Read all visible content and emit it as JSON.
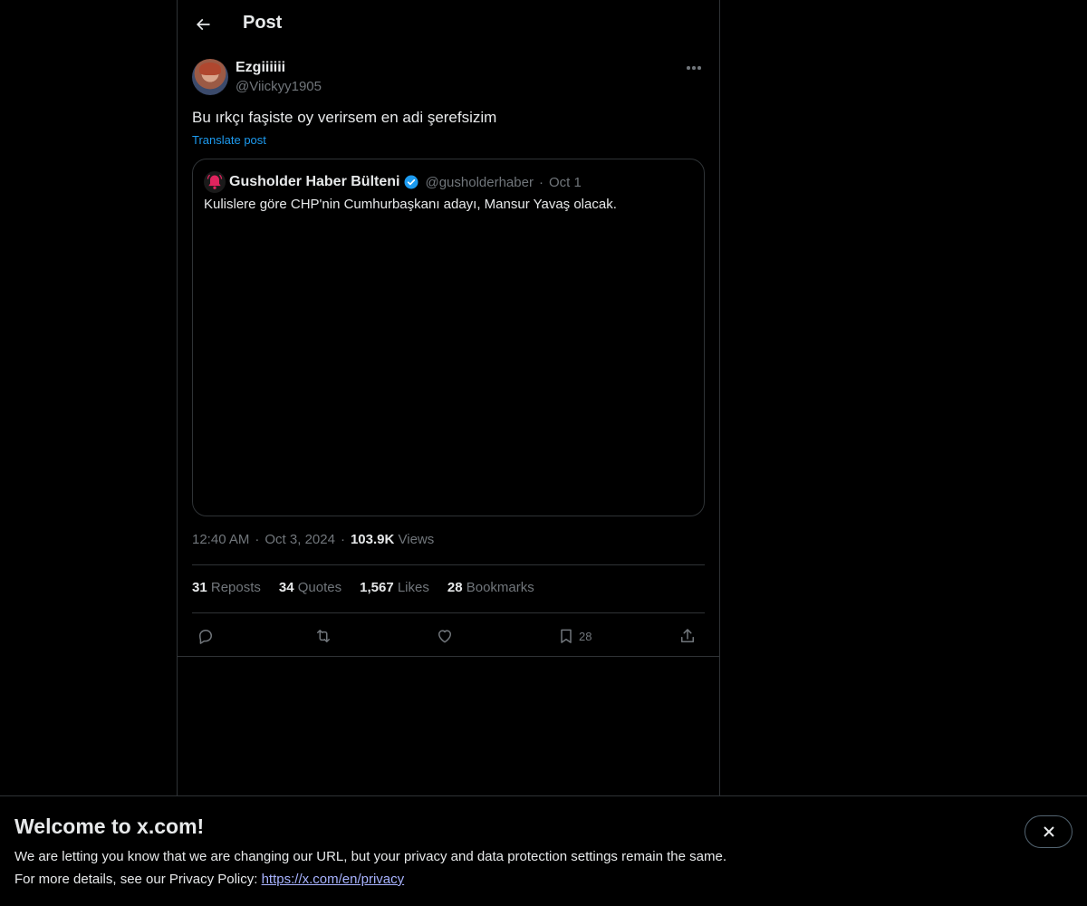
{
  "header": {
    "title": "Post",
    "back_icon": "arrow-left-icon"
  },
  "post": {
    "author_name": "Ezgiiiiii",
    "author_handle": "@Viickyy1905",
    "text": "Bu ırkçı faşiste oy verirsem en adi şerefsizim",
    "translate_label": "Translate post",
    "time": "12:40 AM",
    "date": "Oct 3, 2024",
    "views_count": "103.9K",
    "views_label": "Views"
  },
  "quote": {
    "author_name": "Gusholder Haber Bülteni",
    "author_handle": "@gusholderhaber",
    "date": "Oct 1",
    "text": "Kulislere göre CHP'nin Cumhurbaşkanı adayı, Mansur Yavaş olacak.",
    "verified_color": "#1d9bf0"
  },
  "stats": {
    "reposts_count": "31",
    "reposts_label": "Reposts",
    "quotes_count": "34",
    "quotes_label": "Quotes",
    "likes_count": "1,567",
    "likes_label": "Likes",
    "bookmarks_count": "28",
    "bookmarks_label": "Bookmarks"
  },
  "actions": {
    "bookmark_count": "28",
    "icons": [
      "reply-icon",
      "repost-icon",
      "like-icon",
      "bookmark-icon",
      "share-icon"
    ]
  },
  "banner": {
    "title": "Welcome to x.com!",
    "line1": "We are letting you know that we are changing our URL, but your privacy and data protection settings remain the same.",
    "line2_prefix": "For more details, see our Privacy Policy: ",
    "link": "https://x.com/en/privacy"
  },
  "colors": {
    "accent": "#1d9bf0",
    "background": "#000000",
    "text": "#e7e9ea",
    "muted": "#71767b",
    "border": "#2f3336",
    "link": "#a8b3ff"
  }
}
